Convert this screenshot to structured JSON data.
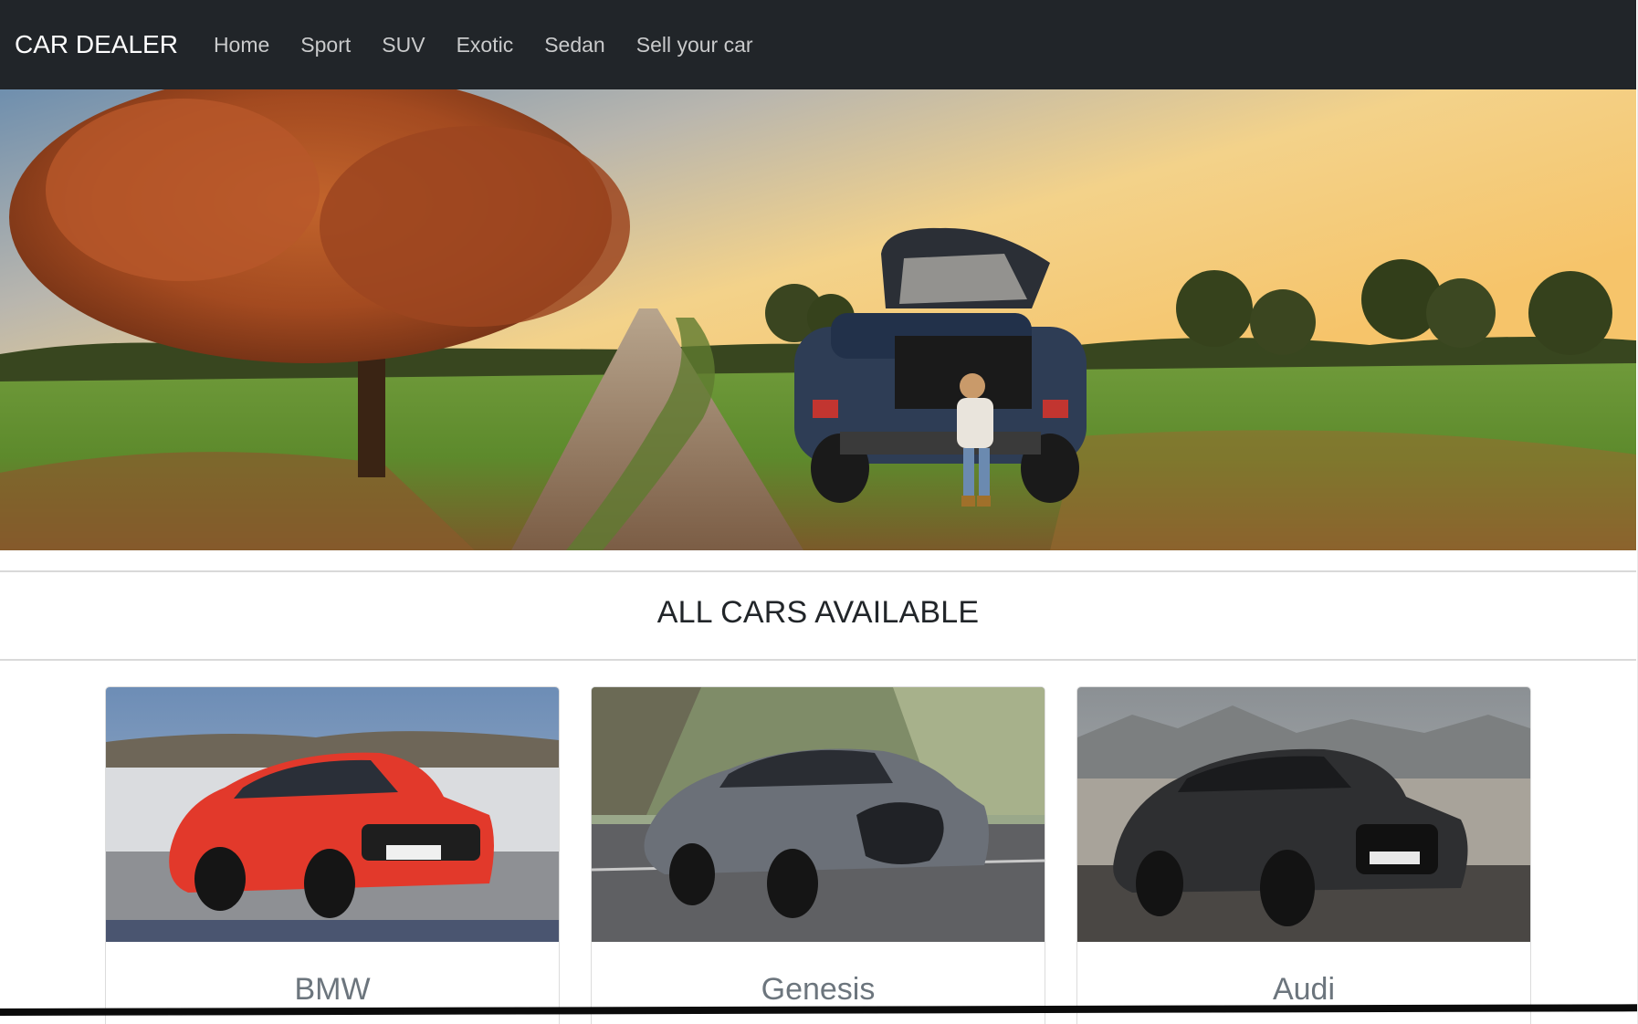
{
  "navbar": {
    "brand": "CAR DEALER",
    "links": [
      "Home",
      "Sport",
      "SUV",
      "Exotic",
      "Sedan",
      "Sell your car"
    ]
  },
  "hero": {
    "image_description": "countryside-road-suv-sunset-photo"
  },
  "section": {
    "title": "ALL CARS AVAILABLE"
  },
  "cards": [
    {
      "title": "BMW",
      "image": "red-bmw-coupe-photo"
    },
    {
      "title": "Genesis",
      "image": "grey-genesis-sedan-photo"
    },
    {
      "title": "Audi",
      "image": "black-audi-suv-photo"
    }
  ],
  "colors": {
    "navbar_bg": "#212529",
    "nav_link": "#c9cacb",
    "card_title": "#6c757d",
    "section_title": "#212529"
  }
}
